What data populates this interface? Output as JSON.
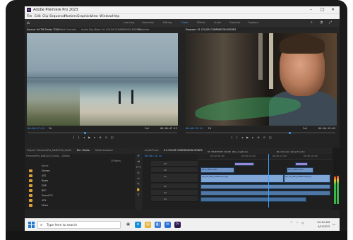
{
  "app": {
    "title": "Adobe Premiere Pro 2023",
    "icon_text": "Pr",
    "window_controls": [
      "–",
      "□",
      "✕"
    ]
  },
  "menu": [
    "File",
    "Edit",
    "Clip",
    "Sequence",
    "Markers",
    "Graphics",
    "View",
    "Window",
    "Help"
  ],
  "workspace_tabs": [
    {
      "label": "Learning",
      "active": false
    },
    {
      "label": "Assembly",
      "active": false
    },
    {
      "label": "Editing",
      "active": false
    },
    {
      "label": "Color",
      "active": true
    },
    {
      "label": "Effects",
      "active": false
    },
    {
      "label": "Audio",
      "active": false
    },
    {
      "label": "Graphics",
      "active": false
    },
    {
      "label": "Captions",
      "active": false
    }
  ],
  "source_panel": {
    "tabs": [
      "Source: 04 TIB Trailer TOSv",
      "Effect Controls",
      "Audio Clip Mixer: 01 COLOR COMPARISON MODES",
      "Metadata"
    ],
    "timecode_in": "00:00:27:24",
    "fit": "Fit",
    "fraction": "Full",
    "timecode_duration": "00:00:47:13"
  },
  "program_panel": {
    "tabs": [
      "Program: 01 COLOR COMPARISON MODES"
    ],
    "timecode_in": "00:00:13:14",
    "fit": "Fit",
    "fraction": "Full",
    "timecode_duration": "00:00:19:09"
  },
  "project_panel": {
    "tabs": [
      "Project: PremierePro_NAB2024_Sizzle",
      "Bin: Media",
      "Media Browser"
    ],
    "path": "PremierePro_NAB2024_Sizzle_...\\Media",
    "items_count": "25 Items",
    "header_name": "Name",
    "folders": [
      "Drones",
      "ATS",
      "Boats",
      "DVE",
      "REC",
      "Sound FX",
      "VFX",
      "Music"
    ]
  },
  "timeline": {
    "tabs": [
      "Audio Track",
      "01 COLOR COMPARISON MODES"
    ],
    "timecode": "00:00:13:14",
    "ruler_labels": [
      "00:00:05:00",
      "00:00:10:00",
      "00:00:15:00",
      "00:00:20:00"
    ],
    "markers": [
      "03 SELECTIVE COLOR (Non-Capture)",
      "04 Colored Selectivity"
    ],
    "video_tracks": [
      "V3",
      "V2",
      "V1"
    ],
    "audio_tracks": [
      "A1",
      "A2",
      "A3"
    ],
    "clips": {
      "v2a": "04 A_0001.mov",
      "v2b": "04 A_0001.mov",
      "v1a": "03_Vid_004_C008.mp4 [V]",
      "v1b": "03_Vid_004_C008.mp4 [V]"
    }
  },
  "taskbar": {
    "search_placeholder": "Type here to search",
    "time": "10:10 AM",
    "date": "4/1/2023",
    "apps": [
      "task-view-icon",
      "edge-icon",
      "file-explorer-icon",
      "store-icon",
      "mail-icon",
      "premiere-icon"
    ]
  },
  "colors": {
    "accent_blue": "#3da0ff",
    "clip_blue": "#6f94c8",
    "clip_purple": "#9d86d4",
    "folder": "#d9a03a"
  },
  "audio_meter_levels": [
    0.7,
    0.72
  ]
}
